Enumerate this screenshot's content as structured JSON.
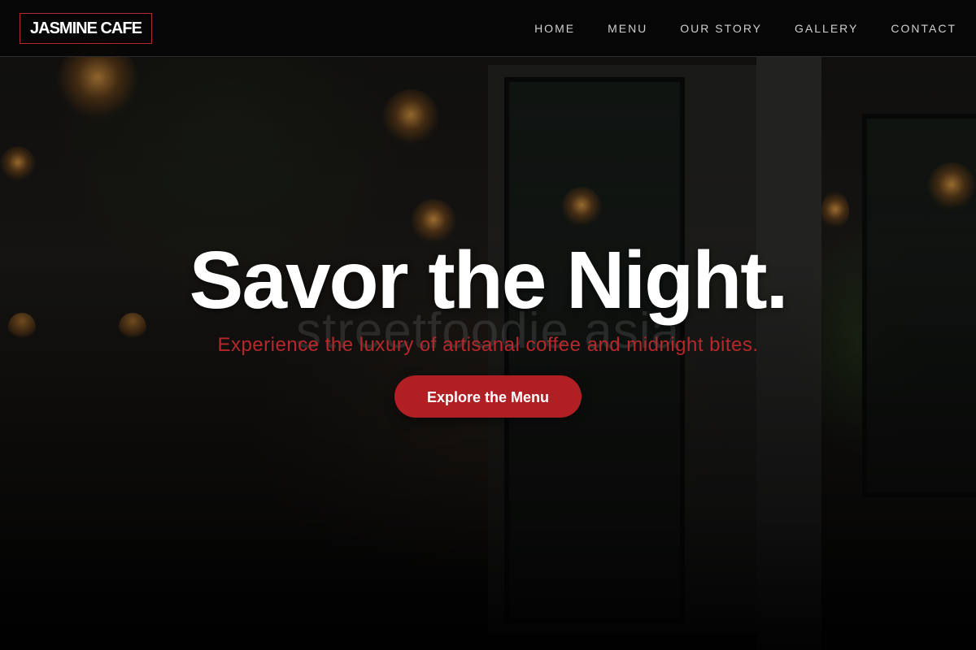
{
  "brand": {
    "logo_text": "JASMINE CAFE",
    "accent_color": "#b01f24"
  },
  "nav": {
    "items": [
      {
        "label": "HOME"
      },
      {
        "label": "MENU"
      },
      {
        "label": "OUR STORY"
      },
      {
        "label": "GALLERY"
      },
      {
        "label": "CONTACT"
      }
    ]
  },
  "hero": {
    "title": "Savor the Night.",
    "subtitle": "Experience the luxury of artisanal coffee and midnight bites.",
    "cta_label": "Explore the Menu",
    "background_watermark": "streetfoodie asia"
  }
}
